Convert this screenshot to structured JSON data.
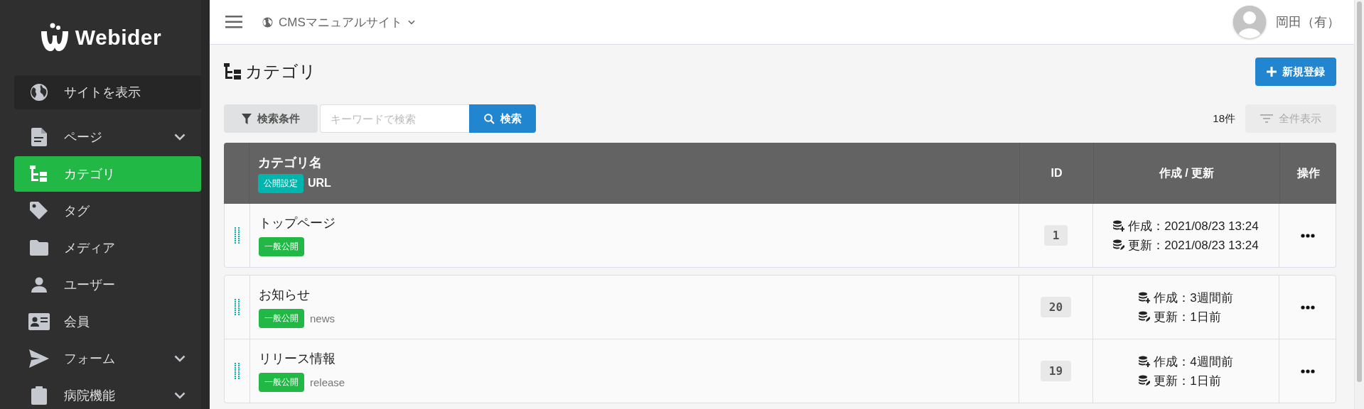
{
  "sidebar": {
    "logo": "Webider",
    "view_site": "サイトを表示",
    "items": [
      {
        "label": "ページ",
        "expandable": true,
        "selected": false
      },
      {
        "label": "カテゴリ",
        "expandable": false,
        "selected": true
      },
      {
        "label": "タグ",
        "expandable": false,
        "selected": false
      },
      {
        "label": "メディア",
        "expandable": false,
        "selected": false
      },
      {
        "label": "ユーザー",
        "expandable": false,
        "selected": false
      },
      {
        "label": "会員",
        "expandable": false,
        "selected": false
      },
      {
        "label": "フォーム",
        "expandable": true,
        "selected": false
      },
      {
        "label": "病院機能",
        "expandable": true,
        "selected": false
      }
    ]
  },
  "topbar": {
    "site": "CMSマニュアルサイト",
    "user": "岡田（有）"
  },
  "page": {
    "title": "カテゴリ",
    "new_button": "新規登録"
  },
  "search": {
    "filter_button": "検索条件",
    "placeholder": "キーワードで検索",
    "search_button": "検索",
    "count": "18件",
    "show_all": {
      "label": "全件表示",
      "disabled": true
    }
  },
  "table": {
    "columns": {
      "name": "カテゴリ名",
      "status": "公開設定",
      "url": "URL",
      "id": "ID",
      "dates": "作成 / 更新",
      "actions": "操作"
    },
    "groups": [
      {
        "rows": [
          {
            "name": "トップページ",
            "status": "一般公開",
            "id": "1",
            "created": "作成：2021/08/23 13:24",
            "updated": "更新：2021/08/23 13:24"
          }
        ]
      },
      {
        "rows": [
          {
            "name": "お知らせ",
            "status": "一般公開",
            "url": "news",
            "id": "20",
            "created": "作成：3週間前",
            "updated": "更新：1日前"
          },
          {
            "name": "リリース情報",
            "status": "一般公開",
            "url": "release",
            "id": "19",
            "created": "作成：4週間前",
            "updated": "更新：1日前"
          }
        ]
      }
    ]
  }
}
